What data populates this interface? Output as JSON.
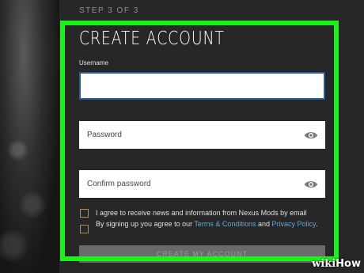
{
  "step": "STEP 3 OF 3",
  "title": "CREATE ACCOUNT",
  "username": {
    "label": "Username",
    "value": ""
  },
  "password": {
    "placeholder": "Password"
  },
  "confirm": {
    "placeholder": "Confirm password"
  },
  "checkboxes": [
    {
      "text": "I agree to receive news and information from Nexus Mods by email",
      "checked": false
    },
    {
      "prefix": "By signing up you agree to our ",
      "terms": "Terms & Conditions",
      "and": " and ",
      "privacy": "Privacy Policy",
      "suffix": ".",
      "checked": false
    }
  ],
  "create_button": "CREATE MY ACCOUNT",
  "watermark": {
    "wiki": "wiki",
    "how": "How"
  },
  "colors": {
    "highlight": "#1ef01e",
    "link": "#5fa8d8",
    "checkbox_border": "#c48a3a"
  },
  "icons": {
    "password_toggle": "eye-icon",
    "confirm_toggle": "eye-icon"
  }
}
